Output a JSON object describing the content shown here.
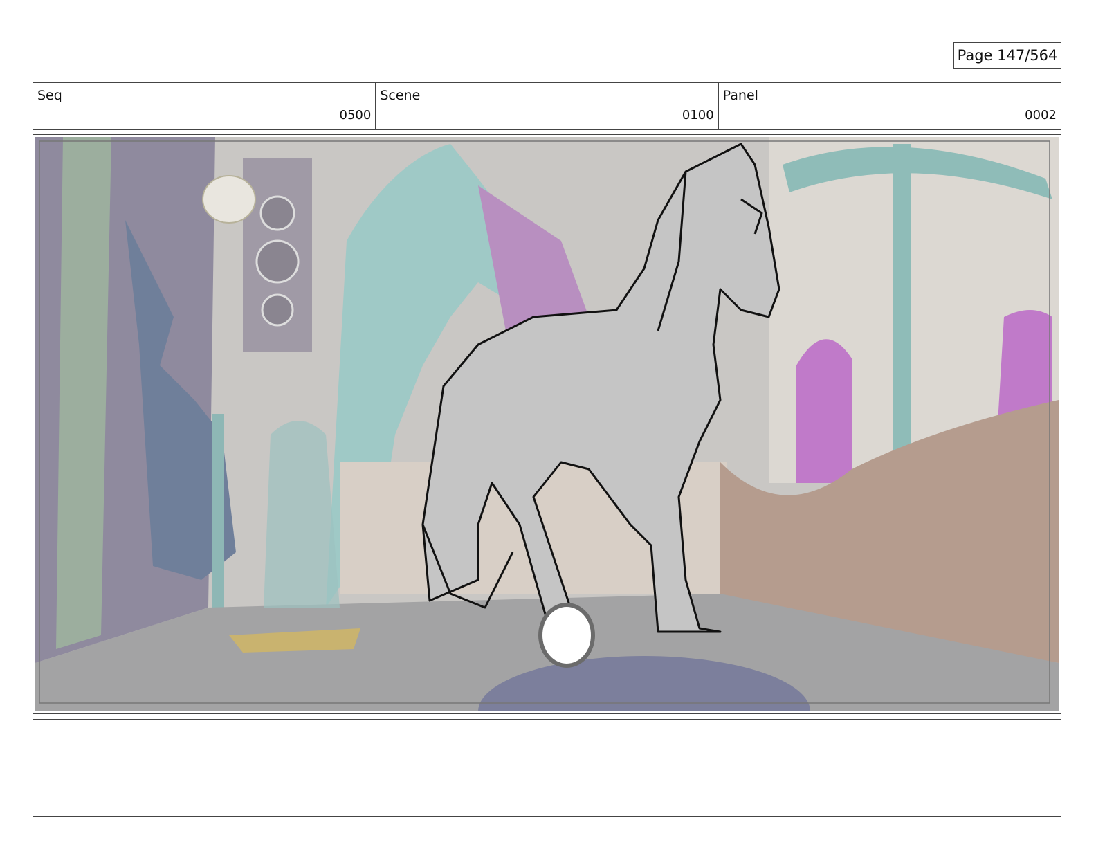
{
  "page": {
    "label": "Page 147/564"
  },
  "header": {
    "seq": {
      "label": "Seq",
      "value": "0500"
    },
    "scene": {
      "label": "Scene",
      "value": "0100"
    },
    "panel": {
      "label": "Panel",
      "value": "0002"
    }
  },
  "panel_image": {
    "subject": "horse-sketch",
    "colors": {
      "floor": "#a3a3a4",
      "wall_left": "#8f8a9e",
      "teal": "#9fc9c6",
      "purple": "#c07ac9",
      "brown_rail": "#b59c8e",
      "horse_fill": "#c5c5c5"
    }
  },
  "notes": {
    "text": ""
  }
}
